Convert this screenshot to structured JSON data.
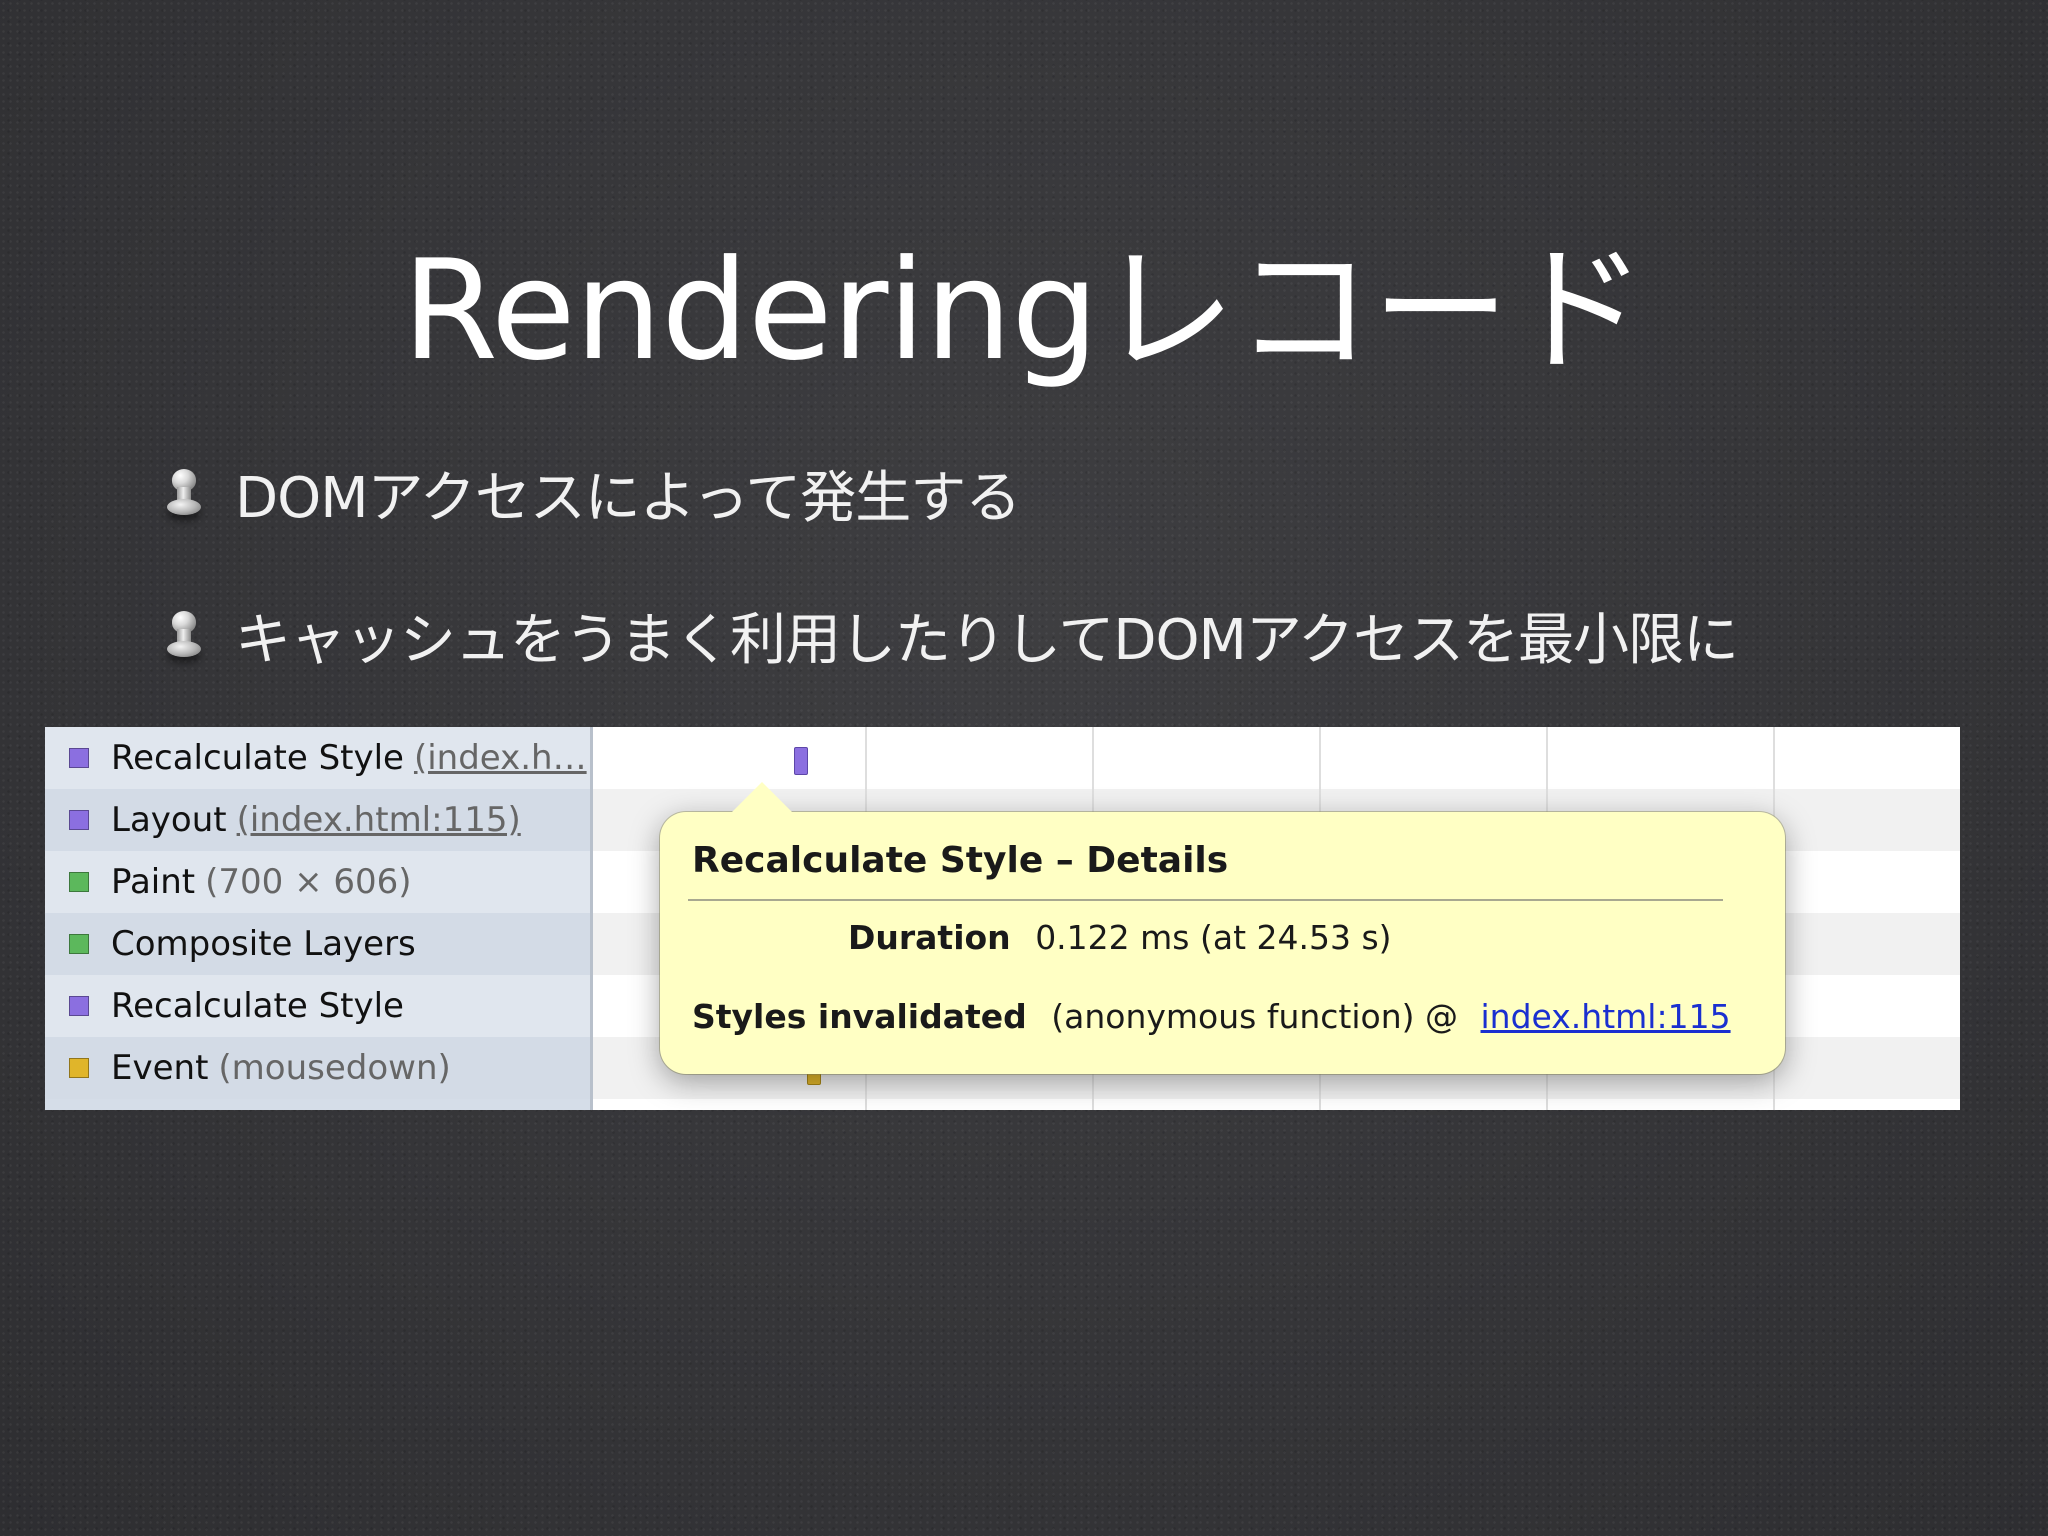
{
  "slide": {
    "title": "Renderingレコード",
    "bullets": [
      "DOMアクセスによって発生する",
      "キャッシュをうまく利用したりしてDOMアクセスを最小限に"
    ]
  },
  "records": [
    {
      "name": "Recalculate Style",
      "detail": "(index.h…",
      "link": true,
      "color": "#8b6fe0",
      "icon": "purple-square-icon"
    },
    {
      "name": "Layout",
      "detail": "(index.html:115)",
      "link": true,
      "color": "#8b6fe0",
      "icon": "purple-square-icon"
    },
    {
      "name": "Paint",
      "detail": "(700 × 606)",
      "link": false,
      "color": "#5cb85c",
      "icon": "green-square-icon"
    },
    {
      "name": "Composite Layers",
      "detail": "",
      "link": false,
      "color": "#5cb85c",
      "icon": "green-square-icon"
    },
    {
      "name": "Recalculate Style",
      "detail": "",
      "link": false,
      "color": "#8b6fe0",
      "icon": "purple-square-icon"
    },
    {
      "name": "Event",
      "detail": "(mousedown)",
      "link": false,
      "color": "#e0b52a",
      "icon": "yellow-square-icon"
    }
  ],
  "tooltip": {
    "title": "Recalculate Style – Details",
    "duration_label": "Duration",
    "duration_value": "0.122 ms (at 24.53 s)",
    "styles_label": "Styles invalidated",
    "styles_value": "(anonymous function) @",
    "styles_link": "index.html:115"
  },
  "colors": {
    "slide_background": "#37373a",
    "tooltip_background": "#ffffc4",
    "link": "#1a2fd0",
    "recalculate_style": "#8b6fe0",
    "paint": "#5cb85c",
    "event": "#e0b52a"
  }
}
